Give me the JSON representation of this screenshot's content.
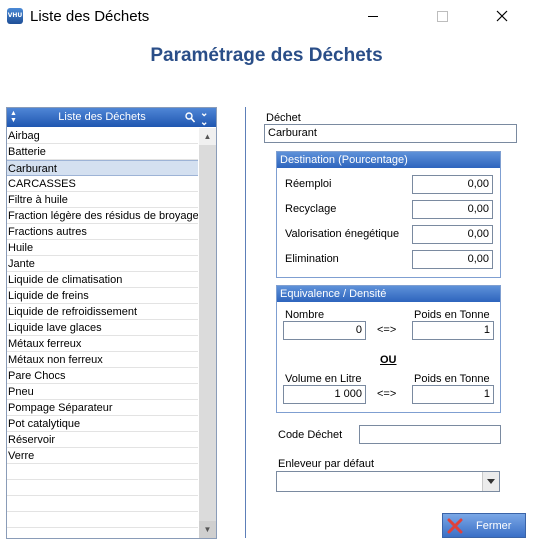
{
  "window": {
    "title": "Liste des Déchets",
    "icon_text": "VHU"
  },
  "heading": "Paramétrage des Déchets",
  "list": {
    "header": "Liste des Déchets",
    "items": [
      "Airbag",
      "Batterie",
      "Carburant",
      "CARCASSES",
      "Filtre à huile",
      "Fraction légère des résidus de broyage",
      "Fractions autres",
      "Huile",
      "Jante",
      "Liquide de climatisation",
      "Liquide de freins",
      "Liquide de refroidissement",
      "Liquide lave glaces",
      "Métaux ferreux",
      "Métaux non ferreux",
      "Pare Chocs",
      "Pneu",
      "Pompage Séparateur",
      "Pot catalytique",
      "Réservoir",
      "Verre"
    ],
    "selected_index": 2
  },
  "form": {
    "dechet_label": "Déchet",
    "dechet_value": "Carburant",
    "destination": {
      "title": "Destination (Pourcentage)",
      "reemploi_label": "Réemploi",
      "reemploi_value": "0,00",
      "recyclage_label": "Recyclage",
      "recyclage_value": "0,00",
      "valorisation_label": "Valorisation énegétique",
      "valorisation_value": "0,00",
      "elimination_label": "Elimination",
      "elimination_value": "0,00"
    },
    "equivalence": {
      "title": "Equivalence / Densité",
      "nombre_label": "Nombre",
      "nombre_value": "0",
      "poids1_label": "Poids en Tonne",
      "poids1_value": "1",
      "arrow": "<=>",
      "ou": "OU",
      "volume_label": "Volume en Litre",
      "volume_value": "1 000",
      "poids2_label": "Poids en Tonne",
      "poids2_value": "1"
    },
    "code_label": "Code Déchet",
    "code_value": "",
    "enleveur_label": "Enleveur par défaut",
    "enleveur_value": ""
  },
  "buttons": {
    "close_label": "Fermer"
  }
}
